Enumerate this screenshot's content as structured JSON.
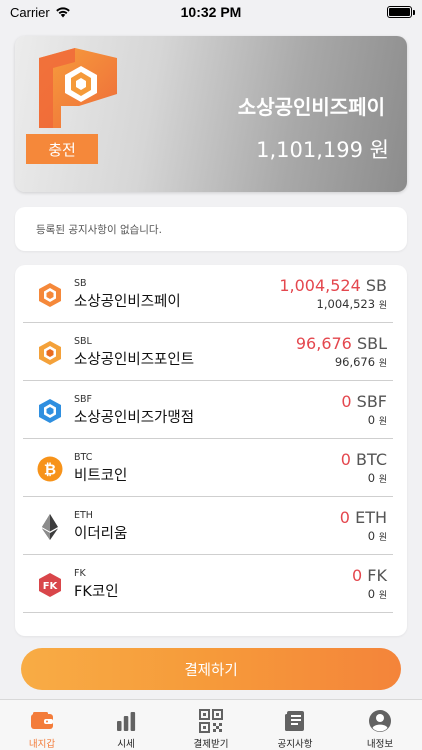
{
  "status_bar": {
    "carrier": "Carrier",
    "time": "10:32 PM"
  },
  "wallet": {
    "name": "소상공인비즈페이",
    "charge_label": "충전",
    "balance": "1,101,199 원"
  },
  "notice": {
    "text": "등록된 공지사항이 없습니다."
  },
  "coins": [
    {
      "symbol": "SB",
      "name": "소상공인비즈페이",
      "amount": "1,004,524",
      "unit": "SB",
      "krw": "1,004,523",
      "won": "원",
      "icon": "sb-coin-icon"
    },
    {
      "symbol": "SBL",
      "name": "소상공인비즈포인트",
      "amount": "96,676",
      "unit": "SBL",
      "krw": "96,676",
      "won": "원",
      "icon": "sbl-coin-icon"
    },
    {
      "symbol": "SBF",
      "name": "소상공인비즈가맹점",
      "amount": "0",
      "unit": "SBF",
      "krw": "0",
      "won": "원",
      "icon": "sbf-coin-icon"
    },
    {
      "symbol": "BTC",
      "name": "비트코인",
      "amount": "0",
      "unit": "BTC",
      "krw": "0",
      "won": "원",
      "icon": "bitcoin-icon"
    },
    {
      "symbol": "ETH",
      "name": "이더리움",
      "amount": "0",
      "unit": "ETH",
      "krw": "0",
      "won": "원",
      "icon": "ethereum-icon"
    },
    {
      "symbol": "FK",
      "name": "FK코인",
      "amount": "0",
      "unit": "FK",
      "krw": "0",
      "won": "원",
      "icon": "fk-coin-icon"
    }
  ],
  "pay_button": {
    "label": "결제하기"
  },
  "tabs": [
    {
      "label": "내지갑",
      "icon": "wallet-icon",
      "active": true
    },
    {
      "label": "시세",
      "icon": "bar-chart-icon",
      "active": false
    },
    {
      "label": "결제받기",
      "icon": "qr-code-icon",
      "active": false
    },
    {
      "label": "공지사항",
      "icon": "notice-icon",
      "active": false
    },
    {
      "label": "내정보",
      "icon": "profile-icon",
      "active": false
    }
  ],
  "colors": {
    "accent": "#f37c3a",
    "amount_red": "#e4474e"
  }
}
